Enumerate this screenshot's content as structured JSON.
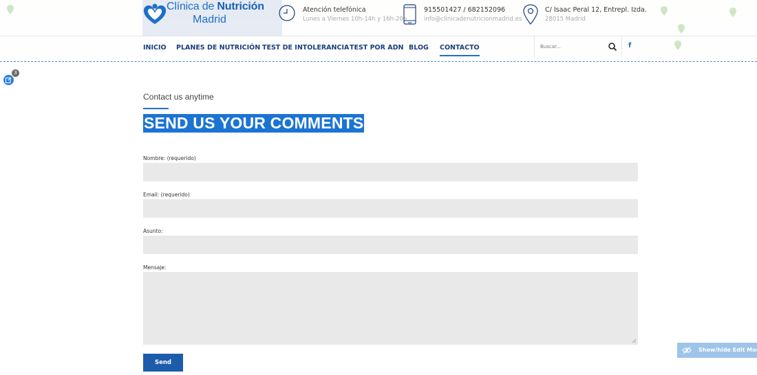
{
  "logo": {
    "line1_a": "Clínica de ",
    "line1_b": "Nutrición",
    "line2": "Madrid"
  },
  "contact_info": [
    {
      "icon": "clock-icon",
      "title": "Atención telefónica",
      "detail": "Lunes a Viernes 10h-14h y 16h-20h"
    },
    {
      "icon": "phone-icon",
      "title": "915501427 / 682152096",
      "detail": "info@clinicadenutricionmadrid.es"
    },
    {
      "icon": "location-pin-icon",
      "title": "C/ Isaac Peral 12, Entrepl. Izda.",
      "detail": "28015 Madrid"
    }
  ],
  "nav": {
    "items": [
      "INICIO",
      "PLANES DE NUTRICIÓN",
      "TEST DE INTOLERANCIA",
      "TEST POR ADN",
      "BLOG",
      "CONTACTO"
    ],
    "active": "CONTACTO",
    "search_placeholder": "Buscar...",
    "facebook": "f"
  },
  "editor": {
    "badge_count": "3",
    "toggle_label": "Show/hide Edit Mod"
  },
  "section": {
    "subtitle": "Contact us anytime",
    "title": "SEND US YOUR COMMENTS"
  },
  "form": {
    "name_label": "Nombre: (requerido)",
    "email_label": "Email: (requerido)",
    "subject_label": "Asunto:",
    "message_label": "Mensaje:",
    "name_value": "",
    "email_value": "",
    "subject_value": "",
    "message_value": "",
    "submit_label": "Send"
  },
  "colors": {
    "brand_blue": "#1e6fc9",
    "nav_text": "#1b3f7a",
    "button": "#1d5cab",
    "field_bg": "#e9e9e9"
  }
}
